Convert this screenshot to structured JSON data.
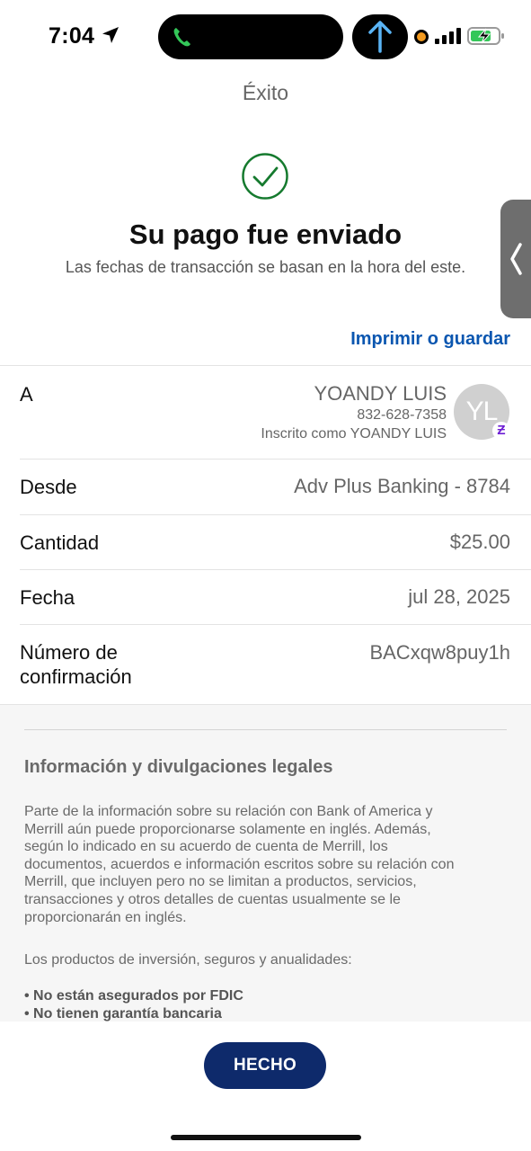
{
  "status_bar": {
    "time": "7:04"
  },
  "header": {
    "title": "Éxito",
    "headline": "Su pago fue enviado",
    "subline": "Las fechas de transacción se basan en la hora del este.",
    "print_link": "Imprimir o guardar"
  },
  "details": {
    "to": {
      "label": "A",
      "name": "YOANDY LUIS",
      "phone": "832-628-7358",
      "enrolled": "Inscrito como YOANDY LUIS",
      "avatar_initials": "YL",
      "badge_glyph": "Ƶ"
    },
    "from": {
      "label": "Desde",
      "value": "Adv Plus Banking - 8784"
    },
    "amount": {
      "label": "Cantidad",
      "value": "$25.00"
    },
    "date": {
      "label": "Fecha",
      "value": "jul 28, 2025"
    },
    "confirmation": {
      "label_line1": "Número de",
      "label_line2": "confirmación",
      "value": "BACxqw8puy1h"
    }
  },
  "legal": {
    "title": "Información y divulgaciones legales",
    "paragraph_lines": [
      "Parte de la información sobre su relación con Bank of America y",
      "Merrill aún puede proporcionarse solamente en inglés. Además,",
      "según lo indicado en su acuerdo de cuenta de Merrill, los",
      "documentos, acuerdos e información escritos sobre su relación con",
      "Merrill, que incluyen pero no se limitan a productos, servicios,",
      "transacciones y otros detalles de cuentas usualmente se le",
      "proporcionarán en inglés."
    ],
    "intro": "Los productos de inversión, seguros y anualidades:",
    "bullets": [
      "• No están asegurados por FDIC",
      "• No tienen garantía bancaria"
    ]
  },
  "actions": {
    "done_label": "HECHO"
  },
  "colors": {
    "link_blue": "#0a56b0",
    "button_navy": "#0e2a6b",
    "success_green": "#157a2e",
    "zelle_purple": "#6d1ed4"
  },
  "icons": [
    "location-arrow-icon",
    "phone-call-icon",
    "upload-arrow-icon",
    "signal-icon",
    "battery-charging-icon",
    "success-check-icon",
    "chevron-left-icon"
  ]
}
